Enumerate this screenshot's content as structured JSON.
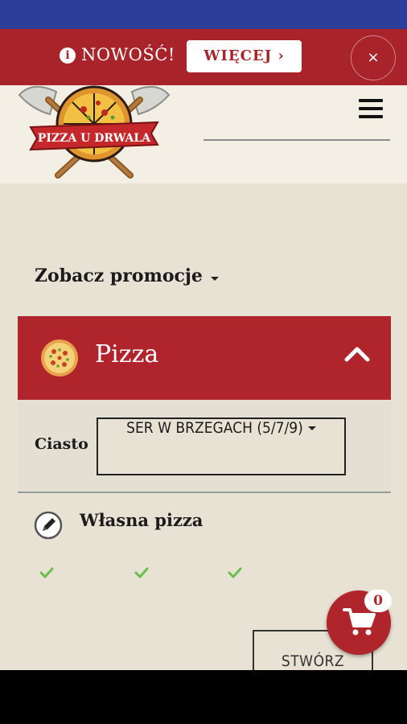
{
  "promo_bar": {
    "info_icon": "info-icon",
    "text": "NOWOŚĆ!",
    "more_label": "WIĘCEJ ›",
    "close_label": "×"
  },
  "header": {
    "logo_text": "PIZZA U DRWALA",
    "menu_icon": "hamburger-menu-icon"
  },
  "promotions_link": "Zobacz promocje",
  "category": {
    "title": "Pizza",
    "icon": "pizza-icon",
    "chevron_icon": "chevron-up-icon"
  },
  "dough": {
    "label": "Ciasto",
    "selected": "SER W BRZEGACH (5/7/9)"
  },
  "product": {
    "title": "Własna pizza",
    "icon": "pencil-icon",
    "checks": [
      "check-icon",
      "check-icon",
      "check-icon"
    ]
  },
  "create_label": "STWÓRZ",
  "cart": {
    "count": "0",
    "icon": "cart-icon"
  },
  "colors": {
    "brand_red": "#b0242b",
    "status_blue": "#2c3e99",
    "background": "#e8e2d4",
    "check_green": "#6abf4b"
  }
}
